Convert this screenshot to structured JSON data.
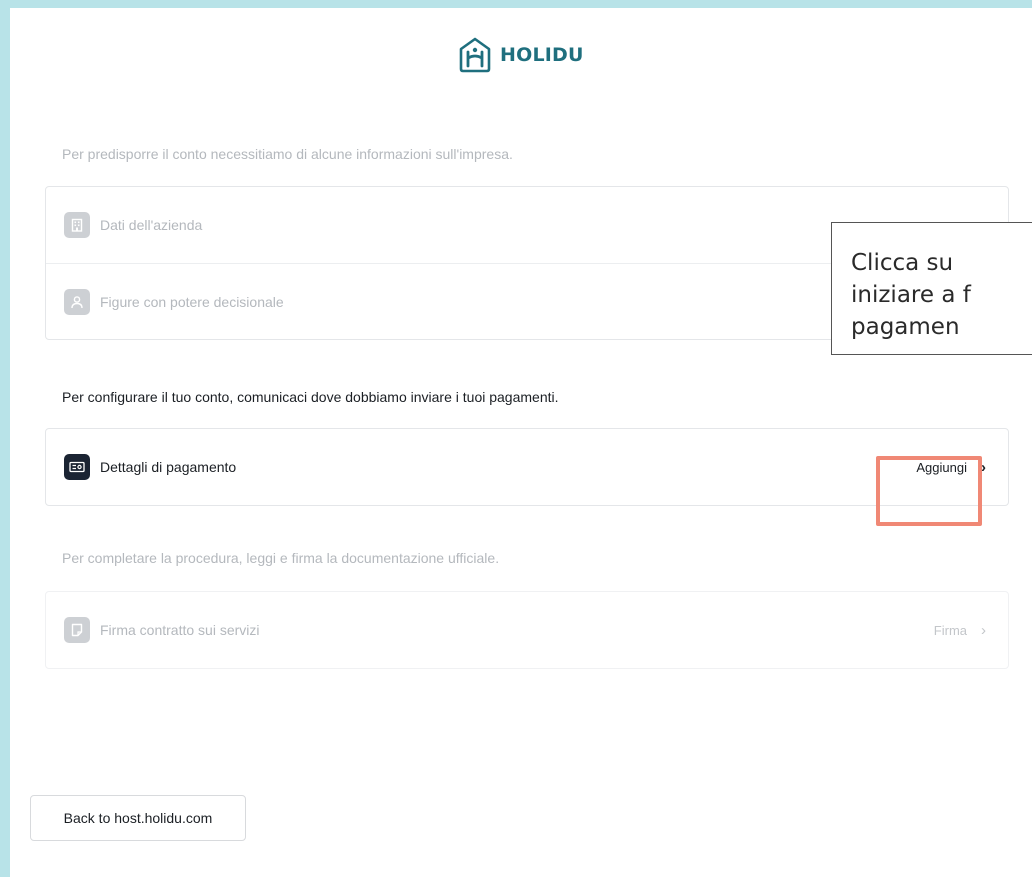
{
  "brand": {
    "name": "HOLIDU",
    "accent_color": "#1f6f7e"
  },
  "sections": {
    "company_info": {
      "text": "Per predisporre il conto necessitiamo di alcune informazioni sull'impresa.",
      "items": [
        {
          "label": "Dati dell'azienda",
          "icon": "building-icon"
        },
        {
          "label": "Figure con potere decisionale",
          "icon": "user-icon"
        }
      ]
    },
    "payment": {
      "text": "Per configurare il tuo conto, comunicaci dove dobbiamo inviare i tuoi pagamenti.",
      "item": {
        "label": "Dettagli di pagamento",
        "action_label": "Aggiungi",
        "icon": "payment-card-icon"
      }
    },
    "contract": {
      "text": "Per completare la procedura, leggi e firma la documentazione ufficiale.",
      "item": {
        "label": "Firma contratto sui servizi",
        "action_label": "Firma",
        "icon": "document-icon"
      }
    }
  },
  "tooltip": {
    "text": "Clicca su \niniziare a f\npagamen"
  },
  "back_button": {
    "label": "Back to host.holidu.com"
  },
  "colors": {
    "background": "#b8e3e8",
    "highlight": "#f08875",
    "muted_text": "#b4b8bd",
    "dark_icon": "#1b2433"
  }
}
